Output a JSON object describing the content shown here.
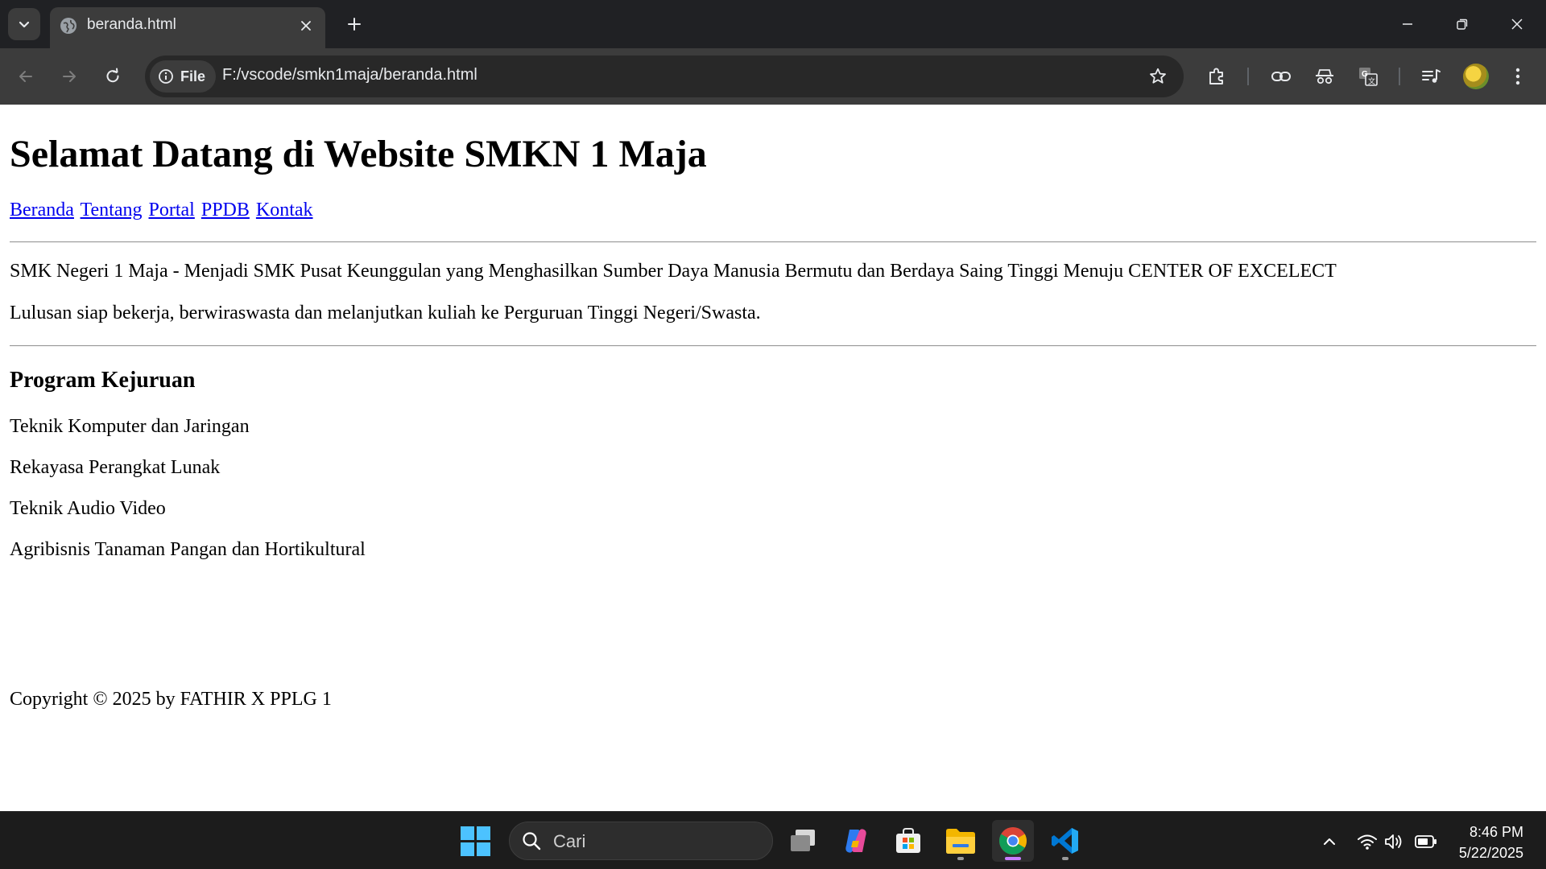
{
  "browser": {
    "tab": {
      "title": "beranda.html"
    },
    "site_chip_label": "File",
    "url": "F:/vscode/smkn1maja/beranda.html"
  },
  "page": {
    "heading": "Selamat Datang di Website SMKN 1 Maja",
    "nav": [
      "Beranda",
      "Tentang",
      "Portal",
      "PPDB",
      "Kontak"
    ],
    "intro": [
      "SMK Negeri 1 Maja - Menjadi SMK Pusat Keunggulan yang Menghasilkan Sumber Daya Manusia Bermutu dan Berdaya Saing Tinggi Menuju CENTER OF EXCELECT",
      "Lulusan siap bekerja, berwiraswasta dan melanjutkan kuliah ke Perguruan Tinggi Negeri/Swasta."
    ],
    "program_heading": "Program Kejuruan",
    "programs": [
      "Teknik Komputer dan Jaringan",
      "Rekayasa Perangkat Lunak",
      "Teknik Audio Video",
      "Agribisnis Tanaman Pangan dan Hortikultural"
    ],
    "footer": "Copyright © 2025 by FATHIR X PPLG 1"
  },
  "taskbar": {
    "search_placeholder": "Cari",
    "time": "8:46 PM",
    "date": "5/22/2025"
  },
  "colors": {
    "link": "#0000ee",
    "chrome_dark": "#202124",
    "toolbar": "#3c3c3c",
    "taskbar": "#1c1c1c"
  }
}
